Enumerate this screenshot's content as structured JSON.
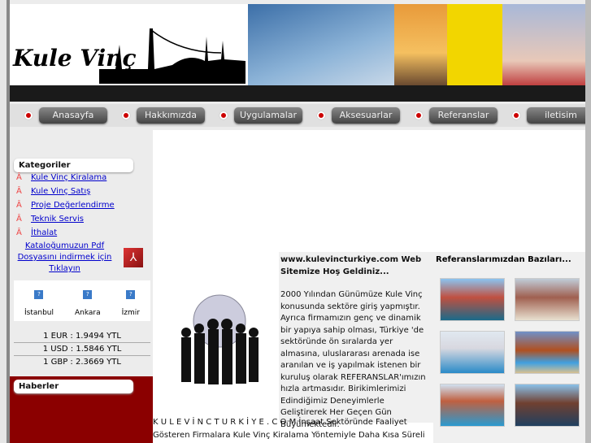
{
  "header": {
    "logo_text": "Kule Vinç"
  },
  "nav": [
    "Anasayfa",
    "Hakkımızda",
    "Uygulamalar",
    "Aksesuarlar",
    "Referanslar",
    "iletisim"
  ],
  "sidebar": {
    "categories_title": "Kategoriler",
    "categories": [
      "Kule Vinç Kiralama",
      "Kule Vinç Satış",
      "Proje Değerlendirme",
      "Teknik Servis",
      "İthalat"
    ],
    "bullet": "Â",
    "catalog_link": "Kataloğumuzun Pdf Dosyasını indirmek için Tıklayın",
    "weather": [
      "İstanbul",
      "Ankara",
      "İzmir"
    ],
    "currency": [
      "1 EUR : 1.9494 YTL",
      "1 USD : 1.5846 YTL",
      "1 GBP : 2.3669 YTL"
    ],
    "news_title": "Haberler"
  },
  "main": {
    "welcome_title": "www.kulevincturkiye.com Web Sitemize Hoş Geldiniz...",
    "welcome_body": "2000 Yılından Günümüze Kule Vinç konusunda sektöre giriş yapmıştır. Ayrıca firmamızın genç ve dinamik bir yapıya sahip olması, Türkiye 'de sektöründe ön sıralarda yer almasına, uluslararası arenada ise aranılan ve iş yapılmak istenen bir kuruluş olarak REFERANSLAR'ımızın hızla artmasıdır. Birikimlerimizi Edindiğimiz Deneyimlerle Geliştirerek Her Geçen Gün Büyümektedir.",
    "refs_title": "Referanslarımızdan Bazıları...",
    "bottom_brand": "K U L E V İ N C T U R K İ Y E . C O M",
    "bottom_text": " İnşaat Sektöründe Faaliyet Gösteren Firmalara Kule Vinç Kiralama Yöntemiyle Daha Kısa Süreli"
  }
}
